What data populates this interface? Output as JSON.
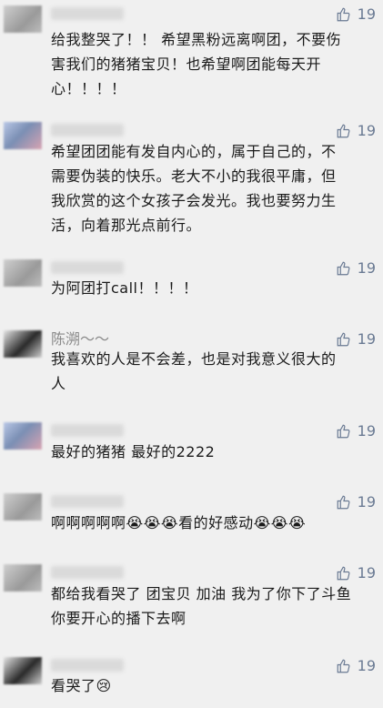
{
  "comments": [
    {
      "name": "",
      "likes": "19",
      "lines": [
        "给我整哭了！！ 希望黑粉远离啊团，不要伤",
        "害我们的猪猪宝贝！也希望啊团能每天开",
        "心！！！！"
      ]
    },
    {
      "name": "",
      "likes": "19",
      "lines": [
        "希望团团能有发自内心的，属于自己的，不",
        "需要伪装的快乐。老大不小的我很平庸，但",
        "我欣赏的这个女孩子会发光。我也要努力生",
        "活，向着那光点前行。"
      ]
    },
    {
      "name": "",
      "likes": "19",
      "lines": [
        "为阿团打call！！！！"
      ]
    },
    {
      "name": "陈溯～～",
      "likes": "19",
      "lines": [
        "我喜欢的人是不会差，也是对我意义很大的",
        "人"
      ]
    },
    {
      "name": "",
      "likes": "19",
      "lines": [
        "最好的猪猪 最好的2222"
      ]
    },
    {
      "name": "",
      "likes": "19",
      "lines": [
        "啊啊啊啊啊😭😭😭看的好感动😭😭😭"
      ]
    },
    {
      "name": "",
      "likes": "19",
      "lines": [
        "都给我看哭了 团宝贝 加油 我为了你下了斗鱼",
        "你要开心的播下去啊"
      ]
    },
    {
      "name": "",
      "likes": "19",
      "lines": [
        "看哭了😢"
      ]
    }
  ],
  "icons": {
    "like": "thumbs-up-icon"
  },
  "colors": {
    "background": "#f0f0f0",
    "like": "#6a7a93",
    "name": "#8a8a8a"
  }
}
